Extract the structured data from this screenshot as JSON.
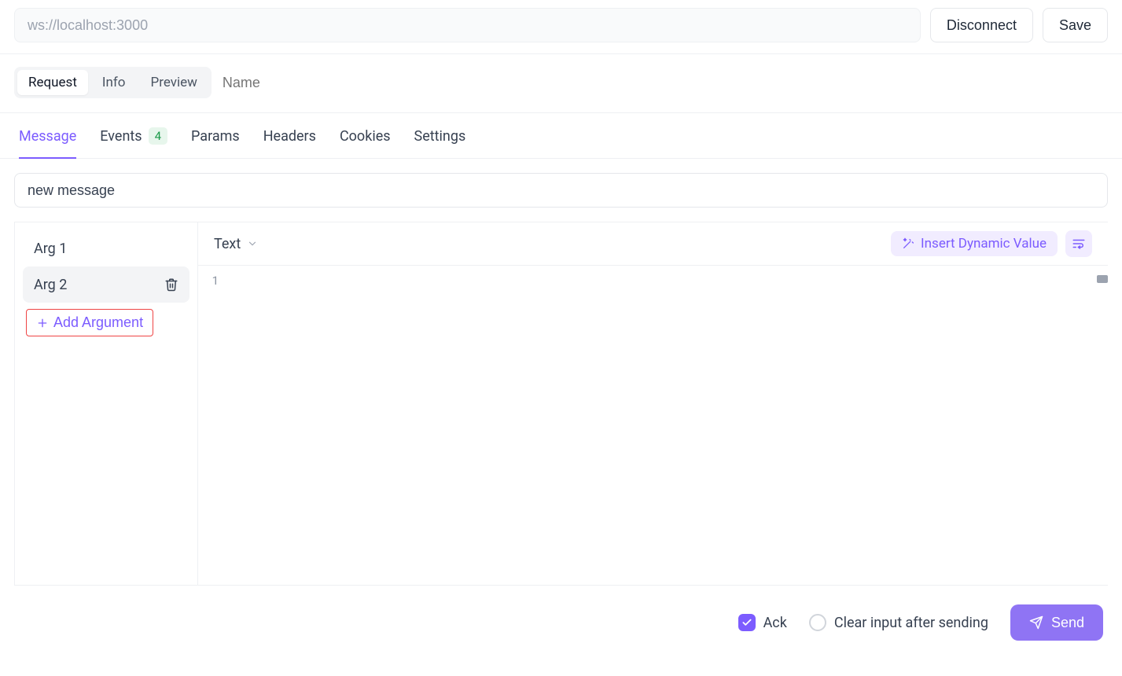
{
  "topbar": {
    "url_value": "ws://localhost:3000",
    "disconnect_label": "Disconnect",
    "save_label": "Save"
  },
  "mode": {
    "tabs": [
      "Request",
      "Info",
      "Preview"
    ],
    "active_index": 0,
    "name_placeholder": "Name"
  },
  "section_tabs": {
    "items": [
      {
        "label": "Message",
        "active": true
      },
      {
        "label": "Events",
        "badge": "4"
      },
      {
        "label": "Params"
      },
      {
        "label": "Headers"
      },
      {
        "label": "Cookies"
      },
      {
        "label": "Settings"
      }
    ]
  },
  "event_name": {
    "value": "new message"
  },
  "args": {
    "items": [
      {
        "label": "Arg 1"
      },
      {
        "label": "Arg 2"
      }
    ],
    "hovered_index": 1,
    "add_label": "Add Argument"
  },
  "editor": {
    "type_label": "Text",
    "insert_dynamic_label": "Insert Dynamic Value",
    "line_numbers": [
      "1"
    ],
    "content": ""
  },
  "footer": {
    "ack_label": "Ack",
    "ack_checked": true,
    "clear_label": "Clear input after sending",
    "clear_checked": false,
    "send_label": "Send"
  },
  "colors": {
    "accent": "#7c5cff",
    "danger_border": "#ef4444",
    "badge_bg": "#e7f6ec",
    "badge_fg": "#1a9a49"
  }
}
